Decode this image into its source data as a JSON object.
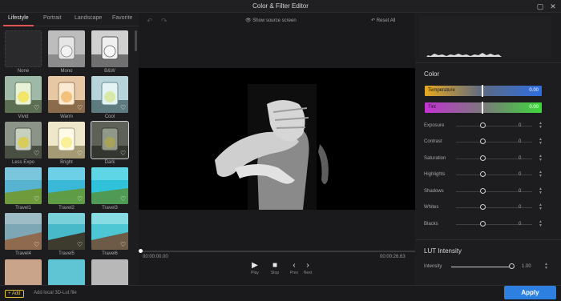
{
  "window": {
    "title": "Color & Filter Editor"
  },
  "tabs": [
    {
      "label": "Lifestyle",
      "active": true
    },
    {
      "label": "Portrait"
    },
    {
      "label": "Landscape"
    },
    {
      "label": "Favorite"
    }
  ],
  "filters": [
    {
      "label": "None"
    },
    {
      "label": "Mono"
    },
    {
      "label": "B&W"
    },
    {
      "label": "Vivid"
    },
    {
      "label": "Warm"
    },
    {
      "label": "Cool"
    },
    {
      "label": "Less Expo"
    },
    {
      "label": "Bright"
    },
    {
      "label": "Dark",
      "selected": true
    },
    {
      "label": "Travel1"
    },
    {
      "label": "Travel2"
    },
    {
      "label": "Travel3"
    },
    {
      "label": "Travel4"
    },
    {
      "label": "Travel5"
    },
    {
      "label": "Travel6"
    }
  ],
  "bottom": {
    "add_label": "+ Add",
    "add_lut_label": "Add local 3D-Lut file",
    "apply_label": "Apply"
  },
  "toolbar": {
    "show_source_label": "Show source screen",
    "reset_label": "Reset All"
  },
  "player": {
    "current_time": "00:00:00.00",
    "total_time": "00:00:26.63",
    "progress_fraction": 0.0,
    "play_label": "Play",
    "stop_label": "Stop",
    "prev_label": "Prev",
    "next_label": "Next"
  },
  "color": {
    "title": "Color",
    "temperature": {
      "label": "Temperature",
      "value": "0.00"
    },
    "tint": {
      "label": "Tint",
      "value": "0.00"
    },
    "adjustments": [
      {
        "label": "Exposure",
        "value": "0"
      },
      {
        "label": "Contrast",
        "value": "0"
      },
      {
        "label": "Saturation",
        "value": "0"
      },
      {
        "label": "Highlights",
        "value": "0"
      },
      {
        "label": "Shadows",
        "value": "0"
      },
      {
        "label": "Whites",
        "value": "0"
      },
      {
        "label": "Blacks",
        "value": "0"
      }
    ]
  },
  "lut": {
    "title": "LUT Intensity",
    "intensity_label": "Intensity",
    "intensity_value": "1.00"
  },
  "colors": {
    "accent": "#2d7fe0",
    "tab_underline": "#e05454",
    "add_button": "#e7c033"
  }
}
